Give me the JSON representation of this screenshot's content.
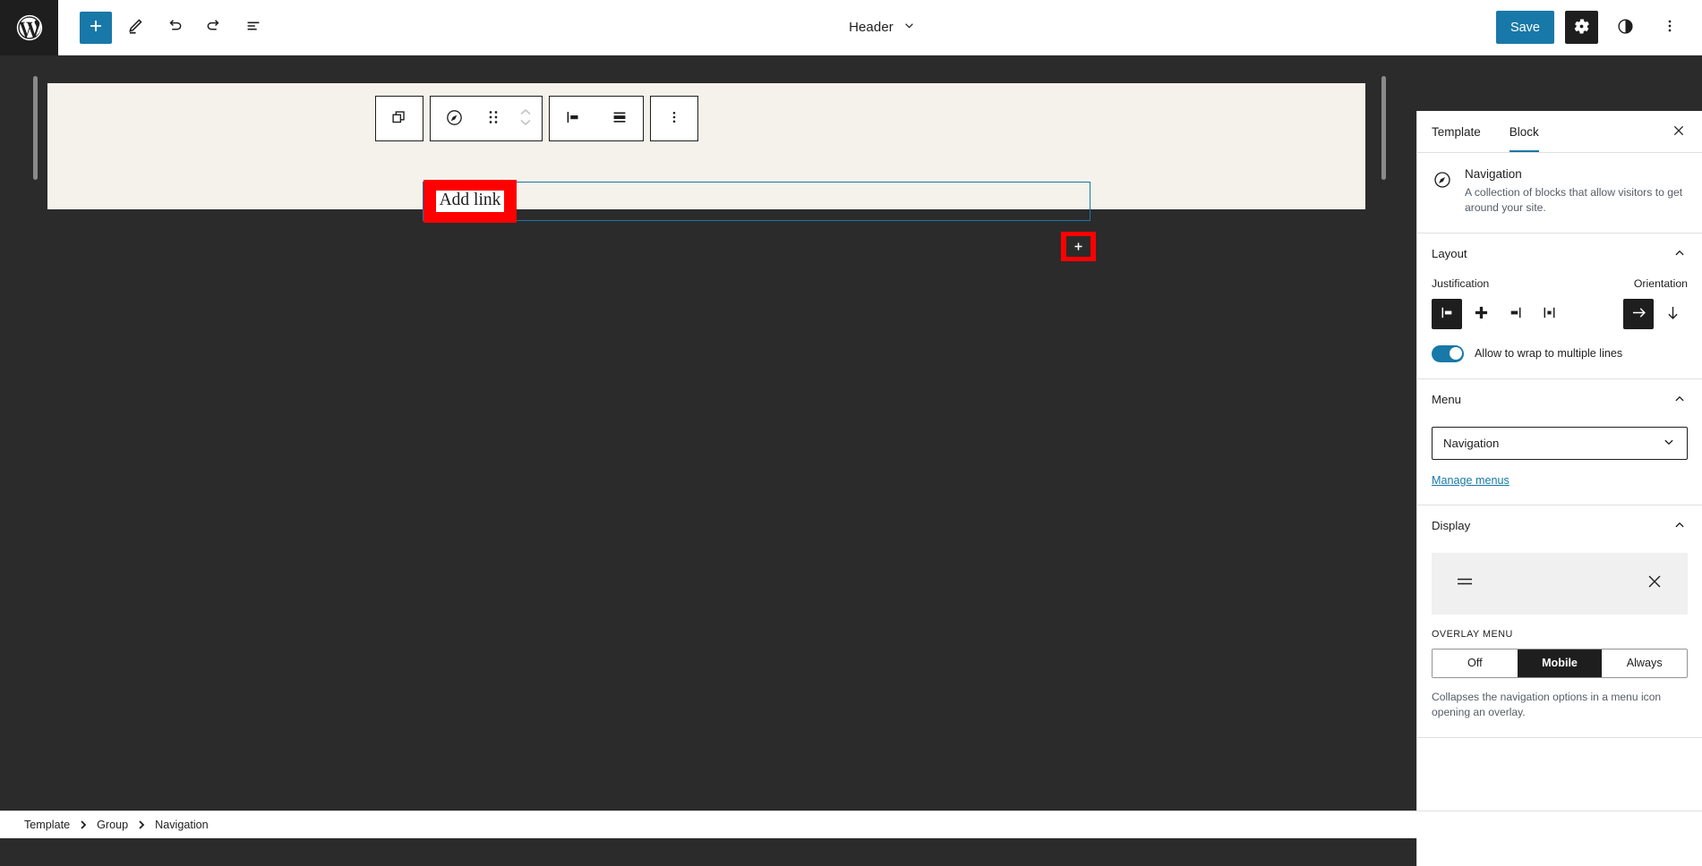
{
  "topbar": {
    "logo_icon": "wordpress-logo-icon",
    "tools": [
      {
        "name": "add-block-button",
        "icon": "plus-icon",
        "label": "Toggle block inserter"
      },
      {
        "name": "edit-tool-button",
        "icon": "pencil-icon",
        "label": "Tools"
      },
      {
        "name": "undo-button",
        "icon": "undo-arrow-icon",
        "label": "Undo"
      },
      {
        "name": "redo-button",
        "icon": "redo-arrow-icon",
        "label": "Redo"
      },
      {
        "name": "list-view-button",
        "icon": "list-view-icon",
        "label": "Document Overview"
      }
    ],
    "document_title": "Header",
    "document_chevron_icon": "chevron-down-icon",
    "save_label": "Save",
    "settings_icon": "gear-icon",
    "styles_icon": "contrast-half-circle-icon",
    "more_icon": "three-dots-vertical-icon",
    "accent_color": "#1878a8",
    "dark_color": "#1e1e1e"
  },
  "block_toolbar": {
    "groups": [
      {
        "buttons": [
          {
            "name": "block-type-navigation-button",
            "icon": "overlapping-squares-icon"
          }
        ]
      },
      {
        "buttons": [
          {
            "name": "navigation-block-icon-button",
            "icon": "compass-circle-icon"
          },
          {
            "name": "drag-handle-button",
            "icon": "six-dots-drag-icon"
          },
          {
            "name": "move-up-down-button",
            "icon": "chevron-up-down-icon"
          }
        ]
      },
      {
        "buttons": [
          {
            "name": "justification-toolbar-button",
            "icon": "justify-left-icon"
          },
          {
            "name": "orientation-toolbar-button",
            "icon": "horizontal-bars-icon"
          }
        ]
      },
      {
        "buttons": [
          {
            "name": "more-options-button",
            "icon": "three-dots-vertical-icon"
          }
        ]
      }
    ]
  },
  "canvas": {
    "background": "#f5f2eb",
    "add_link_label": "Add link",
    "add_link_highlight_color": "#ff0000",
    "appender_icon": "plus-icon",
    "selection_border_color": "#1878a8"
  },
  "sidebar": {
    "tabs": [
      {
        "name": "tab-template",
        "label": "Template",
        "active": false
      },
      {
        "name": "tab-block",
        "label": "Block",
        "active": true
      }
    ],
    "close_icon": "close-x-icon",
    "block_card": {
      "icon": "compass-circle-icon",
      "title": "Navigation",
      "description": "A collection of blocks that allow visitors to get around your site."
    },
    "panels": {
      "layout": {
        "title": "Layout",
        "collapse_icon": "chevron-up-icon",
        "justification_label": "Justification",
        "orientation_label": "Orientation",
        "justification_options": [
          {
            "name": "justify-left-button",
            "icon": "justify-left-icon",
            "selected": true
          },
          {
            "name": "justify-center-button",
            "icon": "justify-center-icon",
            "selected": false
          },
          {
            "name": "justify-right-button",
            "icon": "justify-right-icon",
            "selected": false
          },
          {
            "name": "justify-space-between-button",
            "icon": "justify-space-between-icon",
            "selected": false
          }
        ],
        "orientation_options": [
          {
            "name": "orientation-horizontal-button",
            "icon": "arrow-right-icon",
            "selected": true
          },
          {
            "name": "orientation-vertical-button",
            "icon": "arrow-down-icon",
            "selected": false
          }
        ],
        "wrap_toggle_label": "Allow to wrap to multiple lines",
        "wrap_toggle_on": true
      },
      "menu": {
        "title": "Menu",
        "collapse_icon": "chevron-up-icon",
        "selected_menu": "Navigation",
        "select_chevron_icon": "chevron-down-icon",
        "manage_menus_label": "Manage menus"
      },
      "display": {
        "title": "Display",
        "collapse_icon": "chevron-up-icon",
        "preview_open_icon": "hamburger-menu-icon",
        "preview_close_icon": "close-x-icon",
        "overlay_menu_label": "OVERLAY MENU",
        "overlay_options": [
          {
            "name": "overlay-off-button",
            "label": "Off",
            "selected": false
          },
          {
            "name": "overlay-mobile-button",
            "label": "Mobile",
            "selected": true
          },
          {
            "name": "overlay-always-button",
            "label": "Always",
            "selected": false
          }
        ],
        "help_text": "Collapses the navigation options in a menu icon opening an overlay."
      }
    }
  },
  "breadcrumb": {
    "separator": "›",
    "items": [
      {
        "name": "breadcrumb-template",
        "label": "Template"
      },
      {
        "name": "breadcrumb-group",
        "label": "Group"
      },
      {
        "name": "breadcrumb-navigation",
        "label": "Navigation"
      }
    ]
  }
}
